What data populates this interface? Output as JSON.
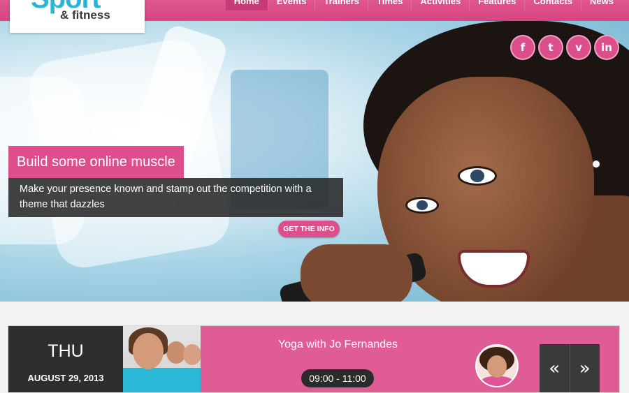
{
  "logo": {
    "name": "Sport",
    "tagline": "& fitness"
  },
  "nav": {
    "items": [
      "Home",
      "Events",
      "Trainers",
      "Times",
      "Activities",
      "Features",
      "Contacts",
      "News"
    ],
    "active": 0
  },
  "social": {
    "icons": [
      {
        "glyph": "f",
        "name": "facebook-icon"
      },
      {
        "glyph": "t",
        "name": "twitter-icon"
      },
      {
        "glyph": "v",
        "name": "vimeo-icon"
      },
      {
        "glyph": "in",
        "name": "linkedin-icon"
      }
    ]
  },
  "hero": {
    "title": "Build some online muscle",
    "description": "Make your presence known and stamp out the competition with a theme that dazzles",
    "button": "GET THE INFO"
  },
  "event": {
    "day": "THU",
    "date": "AUGUST 29, 2013",
    "title": "Yoga with Jo Fernandes",
    "time": "09:00 - 11:00",
    "prev": "«",
    "next": "»"
  },
  "colors": {
    "accent": "#dd4f8c",
    "logo_blue": "#2cb3d6",
    "dark": "#2e2e2e"
  }
}
